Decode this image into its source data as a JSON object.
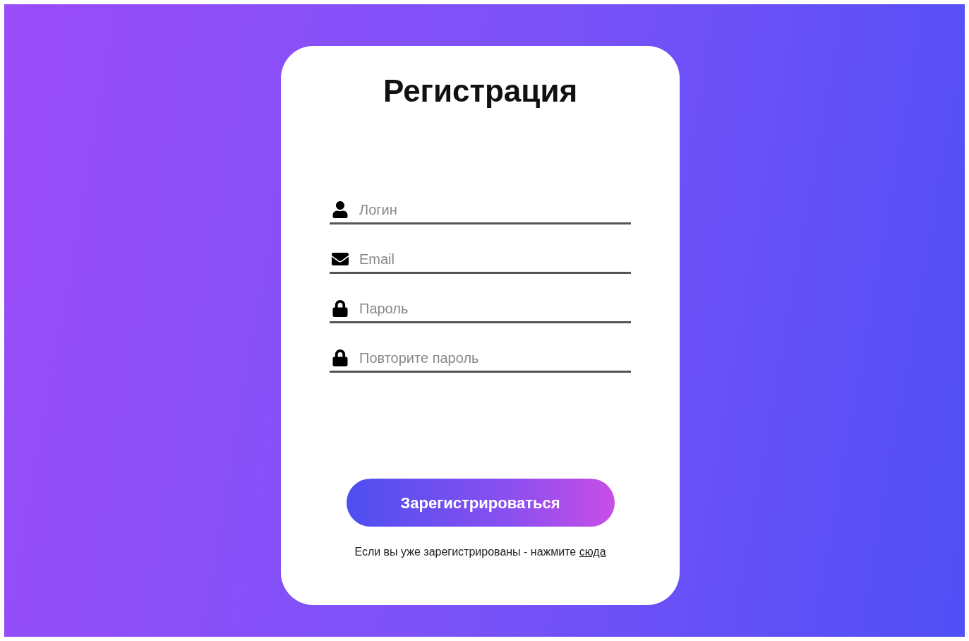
{
  "title": "Регистрация",
  "fields": [
    {
      "kind": "user",
      "placeholder": "Логин"
    },
    {
      "kind": "mail",
      "placeholder": "Email"
    },
    {
      "kind": "lock",
      "placeholder": "Пароль"
    },
    {
      "kind": "lock",
      "placeholder": "Повторите пароль"
    }
  ],
  "submit_button": "Зарегистрироваться",
  "footer": {
    "text": "Если вы уже зарегистрированы - нажмите ",
    "link": "сюда"
  }
}
